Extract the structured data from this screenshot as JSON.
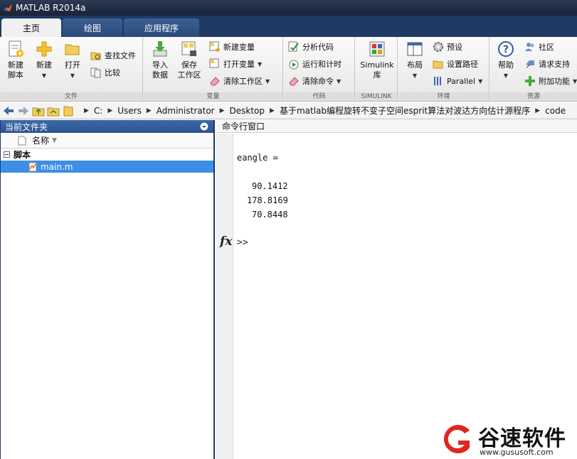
{
  "window": {
    "title": "MATLAB R2014a"
  },
  "tabs": [
    {
      "label": "主页",
      "active": true
    },
    {
      "label": "绘图",
      "active": false
    },
    {
      "label": "应用程序",
      "active": false
    }
  ],
  "ribbon": {
    "file": {
      "label": "文件",
      "new_script": "新建\n脚本",
      "new": "新建",
      "open": "打开",
      "find_files": "查找文件",
      "compare": "比较"
    },
    "variable": {
      "label": "变量",
      "import_data": "导入\n数据",
      "save_workspace": "保存\n工作区",
      "new_variable": "新建变量",
      "open_variable": "打开变量",
      "clear_workspace": "清除工作区"
    },
    "code": {
      "label": "代码",
      "analyze_code": "分析代码",
      "run_and_time": "运行和计时",
      "clear_commands": "清除命令"
    },
    "simulink": {
      "label": "SIMULINK",
      "library": "Simulink\n库"
    },
    "environment": {
      "label": "环境",
      "layout": "布局",
      "preferences": "预设",
      "set_path": "设置路径",
      "parallel": "Parallel"
    },
    "resources": {
      "label": "资源",
      "help": "帮助",
      "community": "社区",
      "request_support": "请求支持",
      "add_ons": "附加功能"
    }
  },
  "address": {
    "crumbs": [
      "C:",
      "Users",
      "Administrator",
      "Desktop",
      "基于matlab编程旋转不变子空间esprit算法对波达方向估计源程序",
      "code"
    ]
  },
  "current_folder": {
    "title": "当前文件夹",
    "column_name": "名称",
    "group_label": "脚本",
    "files": [
      "main.m"
    ]
  },
  "command_window": {
    "title": "命令行窗口",
    "var_line": "eangle =",
    "values": [
      "90.1412",
      "178.8169",
      "70.8448"
    ],
    "prompt": ">>"
  },
  "watermark": {
    "name": "谷速软件",
    "url": "www.gususoft.com"
  },
  "colors": {
    "tab_strip": "#1f3a63",
    "panel_header": "#2a5391",
    "selection": "#3d8ee6",
    "watermark_red": "#e0261d"
  }
}
